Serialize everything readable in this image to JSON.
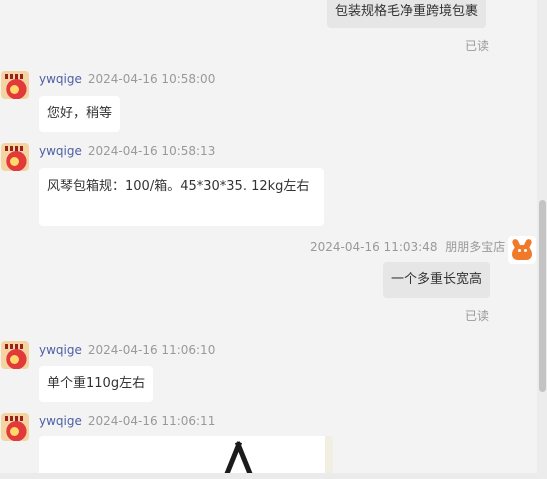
{
  "messages": [
    {
      "text": "包装规格毛净重跨境包裹",
      "read": "已读"
    },
    {
      "sender": "ywqige",
      "time": "2024-04-16 10:58:00",
      "text": "您好，稍等"
    },
    {
      "sender": "ywqige",
      "time": "2024-04-16 10:58:13",
      "text": "风琴包箱规：100/箱。45*30*35.   12kg左右"
    },
    {
      "sender": "朋朋多宝店",
      "time": "2024-04-16 11:03:48",
      "text": "一个多重长宽高",
      "read": "已读"
    },
    {
      "sender": "ywqige",
      "time": "2024-04-16 11:06:10",
      "text": "单个重110g左右"
    },
    {
      "sender": "ywqige",
      "time": "2024-04-16 11:06:11"
    }
  ],
  "icons": {
    "seller_avatar": "seller-avatar-icon",
    "buyer_avatar": "bull-avatar-icon"
  },
  "colors": {
    "background": "#f3f3f3",
    "my_bubble": "#e6e6e6",
    "their_bubble": "#ffffff",
    "sender_name": "#4b5fa5",
    "muted": "#999999"
  }
}
